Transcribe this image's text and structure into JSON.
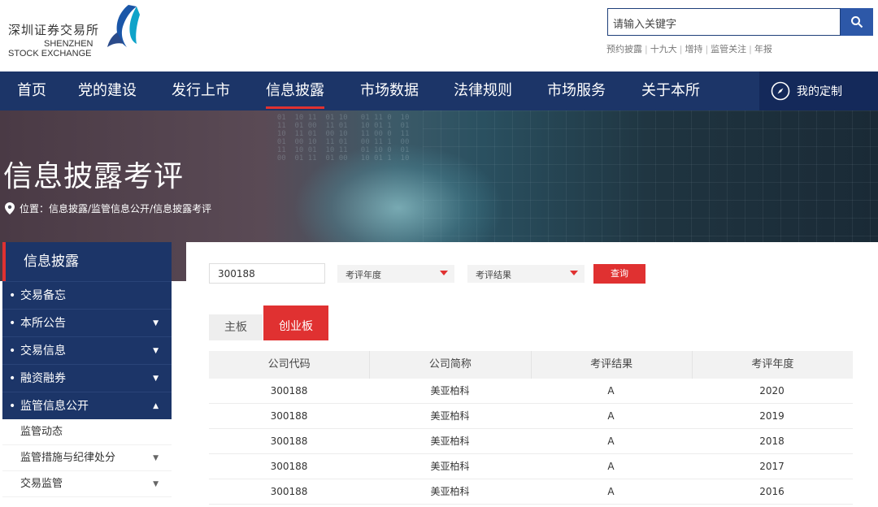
{
  "logo": {
    "cn": "深圳证券交易所",
    "en1": "SHENZHEN",
    "en2": "STOCK EXCHANGE"
  },
  "search": {
    "placeholder": "请输入关键字"
  },
  "quick_links": [
    "预约披露",
    "十九大",
    "增持",
    "监管关注",
    "年报"
  ],
  "nav": {
    "items": [
      "首页",
      "党的建设",
      "发行上市",
      "信息披露",
      "市场数据",
      "法律规则",
      "市场服务",
      "关于本所"
    ],
    "active": "信息披露",
    "custom": "我的定制"
  },
  "banner": {
    "title": "信息披露考评",
    "breadcrumb": "位置：信息披露/监管信息公开/信息披露考评"
  },
  "sidebar": {
    "title": "信息披露",
    "items": [
      {
        "label": "交易备忘",
        "arrow": ""
      },
      {
        "label": "本所公告",
        "arrow": "▼"
      },
      {
        "label": "交易信息",
        "arrow": "▼"
      },
      {
        "label": "融资融券",
        "arrow": "▼"
      },
      {
        "label": "监管信息公开",
        "arrow": "▲"
      }
    ],
    "sub_items": [
      {
        "label": "监管动态",
        "arrow": ""
      },
      {
        "label": "监管措施与纪律处分",
        "arrow": "▼"
      },
      {
        "label": "交易监管",
        "arrow": "▼"
      }
    ]
  },
  "filters": {
    "code_value": "300188",
    "year_select": "考评年度",
    "result_select": "考评结果",
    "query_button": "查询"
  },
  "tabs": {
    "main_board": "主板",
    "chinext": "创业板"
  },
  "table": {
    "headers": [
      "公司代码",
      "公司简称",
      "考评结果",
      "考评年度"
    ],
    "rows": [
      [
        "300188",
        "美亚柏科",
        "A",
        "2020"
      ],
      [
        "300188",
        "美亚柏科",
        "A",
        "2019"
      ],
      [
        "300188",
        "美亚柏科",
        "A",
        "2018"
      ],
      [
        "300188",
        "美亚柏科",
        "A",
        "2017"
      ],
      [
        "300188",
        "美亚柏科",
        "A",
        "2016"
      ]
    ]
  },
  "colors": {
    "navy": "#1c3568",
    "accent_red": "#e03131",
    "search_blue": "#2d58a8"
  }
}
